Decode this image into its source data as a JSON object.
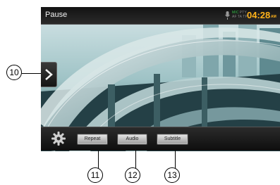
{
  "status_bar": {
    "title": "Pause",
    "indicators": {
      "row1": [
        "MIC",
        "PTY"
      ],
      "row2": [
        "AF",
        "TA",
        "TP"
      ]
    },
    "time": "04:28",
    "ampm": "AM"
  },
  "controls": {
    "repeat_label": "Repeat",
    "audio_label": "Audio",
    "subtitle_label": "Subtitle"
  },
  "callouts": [
    "10",
    "11",
    "12",
    "13"
  ],
  "colors": {
    "clock": "#ffb21a",
    "indicator_green": "#35c24a",
    "indicator_dim": "#888888"
  }
}
